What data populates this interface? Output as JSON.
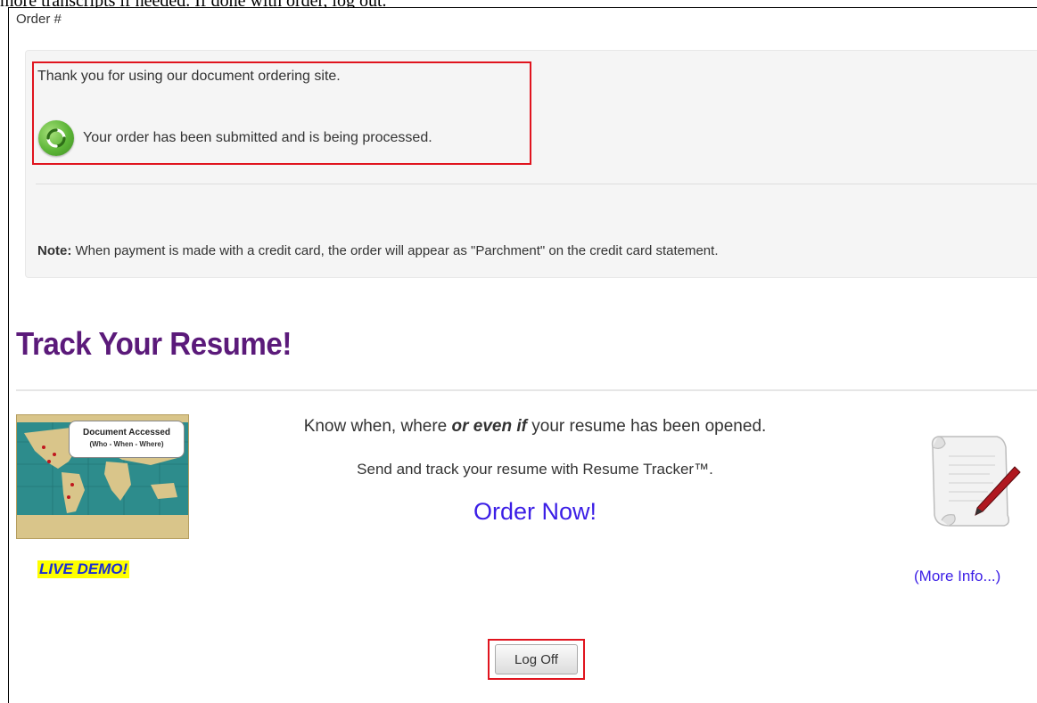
{
  "caption": {
    "text": "more transcripts if needed. If done with order, log out."
  },
  "order": {
    "label": "Order #",
    "thanks": "Thank you for using our document ordering site.",
    "status": "Your order has been submitted and is being processed.",
    "note_label": "Note:",
    "note_text": " When payment is made with a credit card, the order will appear as \"Parchment\" on the credit card statement."
  },
  "tracker": {
    "heading": "Track Your Resume!",
    "map_callout_title": "Document Accessed",
    "map_callout_sub": "(Who - When - Where)",
    "live_demo": "LIVE DEMO!",
    "line1_a": "Know when, where ",
    "line1_em": "or even if",
    "line1_b": " your resume has been opened.",
    "line2": "Send and track your resume with Resume Tracker™.",
    "order_now": "Order Now!",
    "more_info": "(More Info...)"
  },
  "actions": {
    "log_off": "Log Off"
  },
  "colors": {
    "heading": "#5b1a7a",
    "link": "#3b1ee6",
    "highlight_border": "#e0141e",
    "live_demo_bg": "#ffff00",
    "status_icon": "#5cb537"
  },
  "icons": {
    "status": "refresh-circle-icon",
    "map": "world-map-thumbnail",
    "scroll": "scroll-pen-icon"
  }
}
